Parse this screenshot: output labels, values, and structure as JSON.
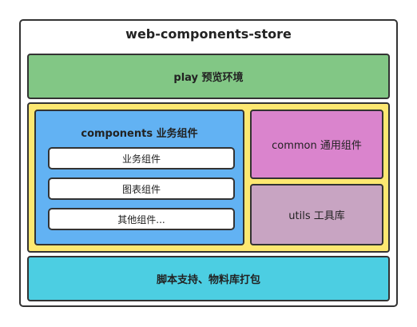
{
  "title": "web-components-store",
  "play": {
    "label": "play 预览环境"
  },
  "components": {
    "label": "components 业务组件",
    "items": [
      "业务组件",
      "图表组件",
      "其他组件..."
    ]
  },
  "common": {
    "label": "common 通用组件"
  },
  "utils": {
    "label": "utils 工具库"
  },
  "build": {
    "label": "脚本支持、物料库打包"
  },
  "colors": {
    "play": "#82c785",
    "container": "#fde871",
    "components": "#62b2f3",
    "common": "#da84cd",
    "utils": "#c8a4c2",
    "build": "#4ccee2",
    "border": "#333333"
  }
}
